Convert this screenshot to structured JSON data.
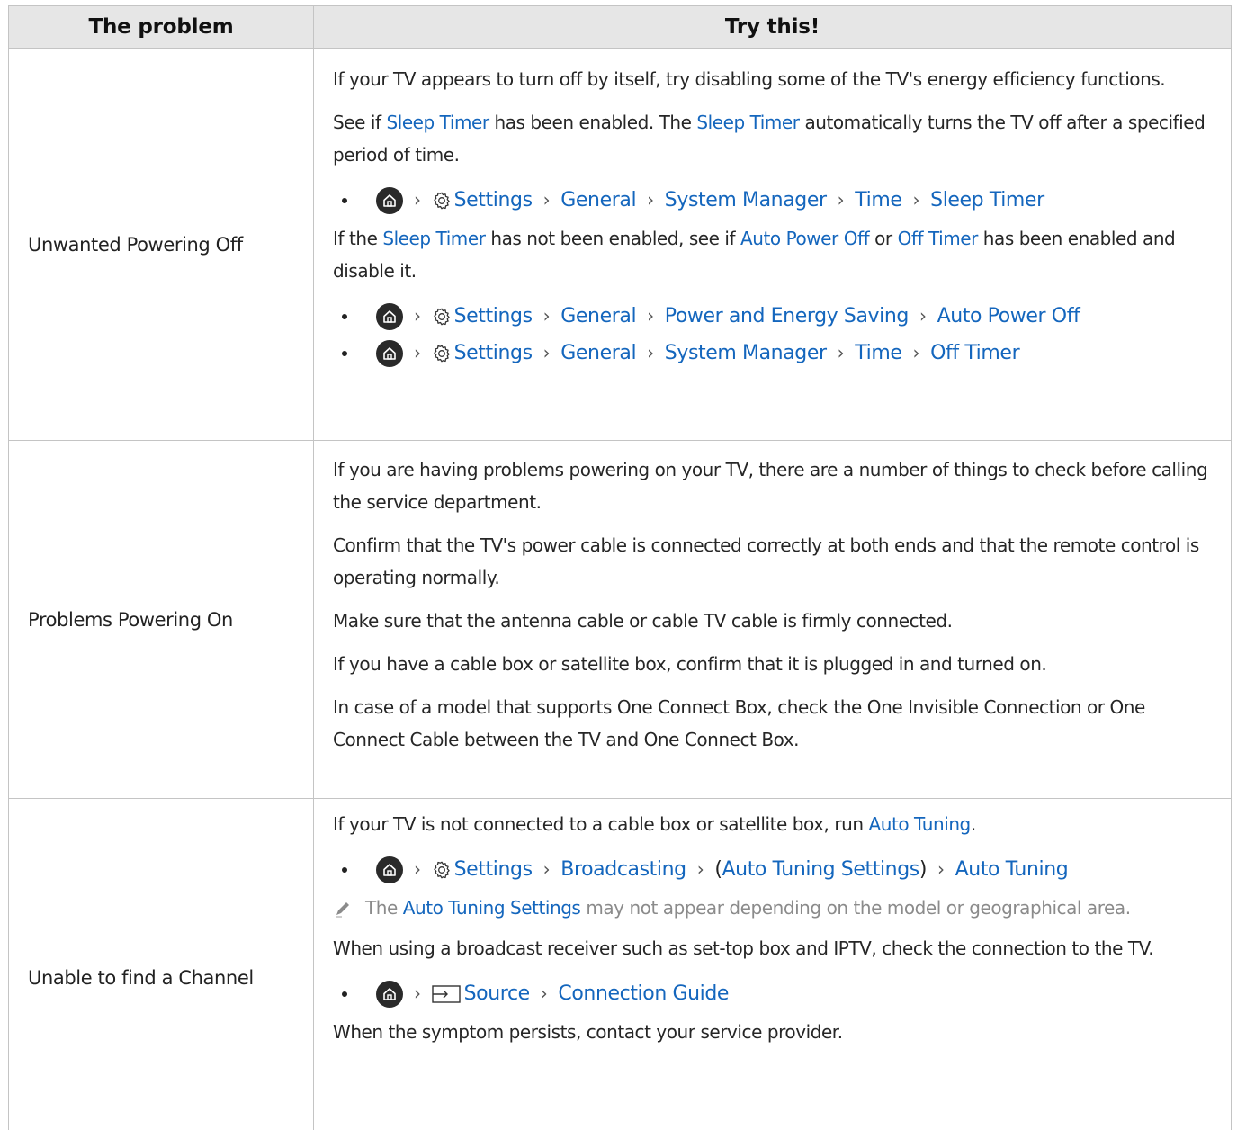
{
  "header": {
    "col_problem": "The problem",
    "col_try": "Try this!"
  },
  "rows": [
    {
      "problem": "Unwanted Powering Off",
      "p1": "If your TV appears to turn off by itself, try disabling some of the TV's energy efficiency functions.",
      "p2": {
        "a": "See if ",
        "sleep1": "Sleep Timer",
        "b": " has been enabled. The ",
        "sleep2": "Sleep Timer",
        "c": " automatically turns the TV off after a specified period of time."
      },
      "path1": [
        "Settings",
        "General",
        "System Manager",
        "Time",
        "Sleep Timer"
      ],
      "p3": {
        "a": "If the ",
        "sleep": "Sleep Timer",
        "b": " has not been enabled, see if ",
        "apo": "Auto Power Off",
        "c": " or ",
        "off": "Off Timer",
        "d": " has been enabled and disable it."
      },
      "path2": [
        "Settings",
        "General",
        "Power and Energy Saving",
        "Auto Power Off"
      ],
      "path3": [
        "Settings",
        "General",
        "System Manager",
        "Time",
        "Off Timer"
      ]
    },
    {
      "problem": "Problems Powering On",
      "p1": "If you are having problems powering on your TV, there are a number of things to check before calling the service department.",
      "p2": "Confirm that the TV's power cable is connected correctly at both ends and that the remote control is operating normally.",
      "p3": "Make sure that the antenna cable or cable TV cable is firmly connected.",
      "p4": "If you have a cable box or satellite box, confirm that it is plugged in and turned on.",
      "p5": "In case of a model that supports One Connect Box, check the One Invisible Connection or One Connect Cable between the TV and One Connect Box."
    },
    {
      "problem": "Unable to find a Channel",
      "p1": {
        "a": "If your TV is not connected to a cable box or satellite box, run ",
        "link": "Auto Tuning",
        "b": "."
      },
      "path1": {
        "settings": "Settings",
        "broadcasting": "Broadcasting",
        "open": "(",
        "ats": "Auto Tuning Settings",
        "close": ")",
        "at": "Auto Tuning"
      },
      "note": {
        "a": "The ",
        "link": "Auto Tuning Settings",
        "b": " may not appear depending on the model or geographical area."
      },
      "p2": "When using a broadcast receiver such as set-top box and IPTV, check the connection to the TV.",
      "path2": [
        "Source",
        "Connection Guide"
      ],
      "p3": "When the symptom persists, contact your service provider."
    }
  ],
  "icons": {
    "home": "home-icon",
    "settings": "gear-icon",
    "source": "source-input-icon",
    "note": "pencil-note-icon",
    "separator": "chevron-right-icon"
  },
  "colors": {
    "link": "#1466bd",
    "header_bg": "#e6e6e6",
    "border": "#c4c4c4",
    "note_text": "#8b8b8b"
  }
}
